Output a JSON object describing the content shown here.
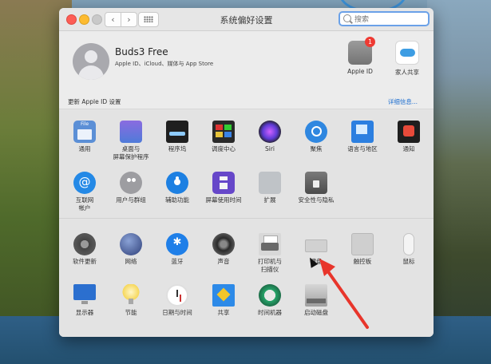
{
  "window": {
    "title": "系统偏好设置",
    "search_placeholder": "搜索"
  },
  "account": {
    "name": "Buds3 Free",
    "subtitle": "Apple ID、iCloud、媒体与 App Store",
    "apple_id_label": "Apple ID",
    "apple_id_badge": "1",
    "family_label": "家人共享"
  },
  "update_strip": {
    "left": "更新 Apple ID 设置",
    "right": "详细信息..."
  },
  "section1": [
    {
      "label": "通用",
      "icon": "general-icon"
    },
    {
      "label": "桌面与\n屏幕保护程序",
      "icon": "desktop-icon"
    },
    {
      "label": "程序坞",
      "icon": "dock-icon"
    },
    {
      "label": "调度中心",
      "icon": "mission-control-icon"
    },
    {
      "label": "Siri",
      "icon": "siri-icon"
    },
    {
      "label": "聚焦",
      "icon": "spotlight-icon"
    },
    {
      "label": "语言与地区",
      "icon": "language-region-icon"
    },
    {
      "label": "通知",
      "icon": "notifications-icon"
    },
    {
      "label": "互联网\n帐户",
      "icon": "internet-accounts-icon"
    },
    {
      "label": "用户与群组",
      "icon": "users-groups-icon"
    },
    {
      "label": "辅助功能",
      "icon": "accessibility-icon"
    },
    {
      "label": "屏幕使用时间",
      "icon": "screen-time-icon"
    },
    {
      "label": "扩展",
      "icon": "extensions-icon"
    },
    {
      "label": "安全性与隐私",
      "icon": "security-privacy-icon"
    }
  ],
  "section2": [
    {
      "label": "软件更新",
      "icon": "software-update-icon"
    },
    {
      "label": "网络",
      "icon": "network-icon"
    },
    {
      "label": "蓝牙",
      "icon": "bluetooth-icon"
    },
    {
      "label": "声音",
      "icon": "sound-icon"
    },
    {
      "label": "打印机与\n扫描仪",
      "icon": "printers-scanners-icon"
    },
    {
      "label": "键盘",
      "icon": "keyboard-icon"
    },
    {
      "label": "触控板",
      "icon": "trackpad-icon"
    },
    {
      "label": "鼠标",
      "icon": "mouse-icon"
    },
    {
      "label": "显示器",
      "icon": "displays-icon"
    },
    {
      "label": "节能",
      "icon": "energy-saver-icon"
    },
    {
      "label": "日期与时间",
      "icon": "date-time-icon"
    },
    {
      "label": "共享",
      "icon": "sharing-icon"
    },
    {
      "label": "时间机器",
      "icon": "time-machine-icon"
    },
    {
      "label": "启动磁盘",
      "icon": "startup-disk-icon"
    }
  ],
  "colors": {
    "accent": "#1f6fd0",
    "annotation_arrow": "#e8352b",
    "badge": "#ee3a33"
  }
}
